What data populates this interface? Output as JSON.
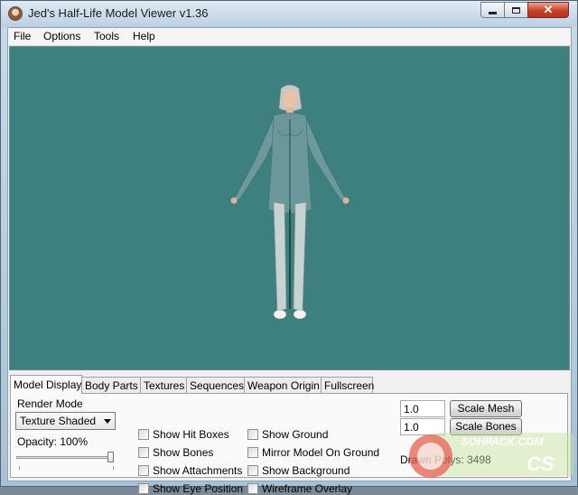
{
  "window": {
    "title": "Jed's Half-Life Model Viewer v1.36",
    "icon": "app-face-icon",
    "controls": {
      "minimize": "minimize-icon",
      "maximize": "maximize-icon",
      "close": "close-icon"
    },
    "close_glyph": "✕"
  },
  "menubar": {
    "items": [
      "File",
      "Options",
      "Tools",
      "Help"
    ]
  },
  "viewport": {
    "background_color": "#3e7f7f"
  },
  "tabs": {
    "items": [
      "Model Display",
      "Body Parts",
      "Textures",
      "Sequences",
      "Weapon Origin",
      "Fullscreen"
    ],
    "active": "Model Display"
  },
  "panel": {
    "render_mode_label": "Render Mode",
    "render_mode_value": "Texture Shaded",
    "opacity_label": "Opacity: 100%",
    "opacity_value": 1.0,
    "checkboxes_col1": [
      "Show Hit Boxes",
      "Show Bones",
      "Show Attachments",
      "Show Eye Position"
    ],
    "checkboxes_col2": [
      "Show Ground",
      "Mirror Model On Ground",
      "Show Background",
      "Wireframe Overlay"
    ],
    "scale_mesh_value": "1.0",
    "scale_bones_value": "1.0",
    "scale_mesh_button": "Scale Mesh",
    "scale_bones_button": "Scale Bones",
    "drawn_polys": "Drawn Polys: 3498"
  },
  "watermark": {
    "text": "SOHPACK.COM",
    "text2": "CS",
    "logo": "soupack-logo-icon"
  }
}
